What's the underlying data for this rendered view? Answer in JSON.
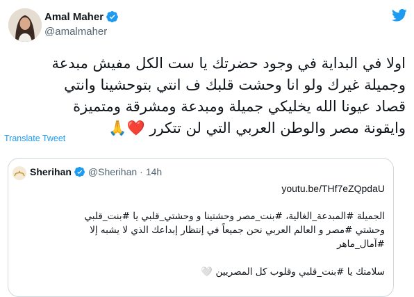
{
  "tweet": {
    "author_name": "Amal Maher",
    "author_handle": "@amalmaher",
    "text_lines": [
      "اولا في البداية في وجود حضرتك يا ست الكل مفيش مبدعة",
      "وجميلة غيرك  ولو انا وحشت قلبك ف انتي بتوحشينا وانتي",
      "قصاد عيونا الله يخليكي جميلة ومبدعة ومشرقة ومتميزة",
      "وايقونة مصر والوطن العربي التي لن تتكرر ❤️🙏"
    ],
    "translate_label": "Translate Tweet"
  },
  "quote": {
    "author_name": "Sherihan",
    "author_handle": "@Sherihan",
    "separator": "·",
    "time": "14h",
    "link": "youtu.be/THf7eZQpdaU",
    "paragraph_lines": [
      "الجميلة #المبدعة_الغالية، #بنت_مصر وحشتينا و وحشتي_قلبي يا #بنت_قلبي",
      "وحشتي #مصر و العالم العربي نحن جميعاً في إنتظار إبداعك الذي لا يشبه إلا",
      "#آمال_ماهر"
    ],
    "closing_line": "سلامتك يا #بنت_قلبي وقلوب كل المصريين 🤍"
  },
  "icons": {
    "verified": "verified-badge-icon",
    "twitter": "twitter-bird-icon"
  },
  "colors": {
    "accent": "#1d9bf0",
    "text": "#0f1419",
    "muted": "#536471",
    "border": "#cfd9de"
  }
}
